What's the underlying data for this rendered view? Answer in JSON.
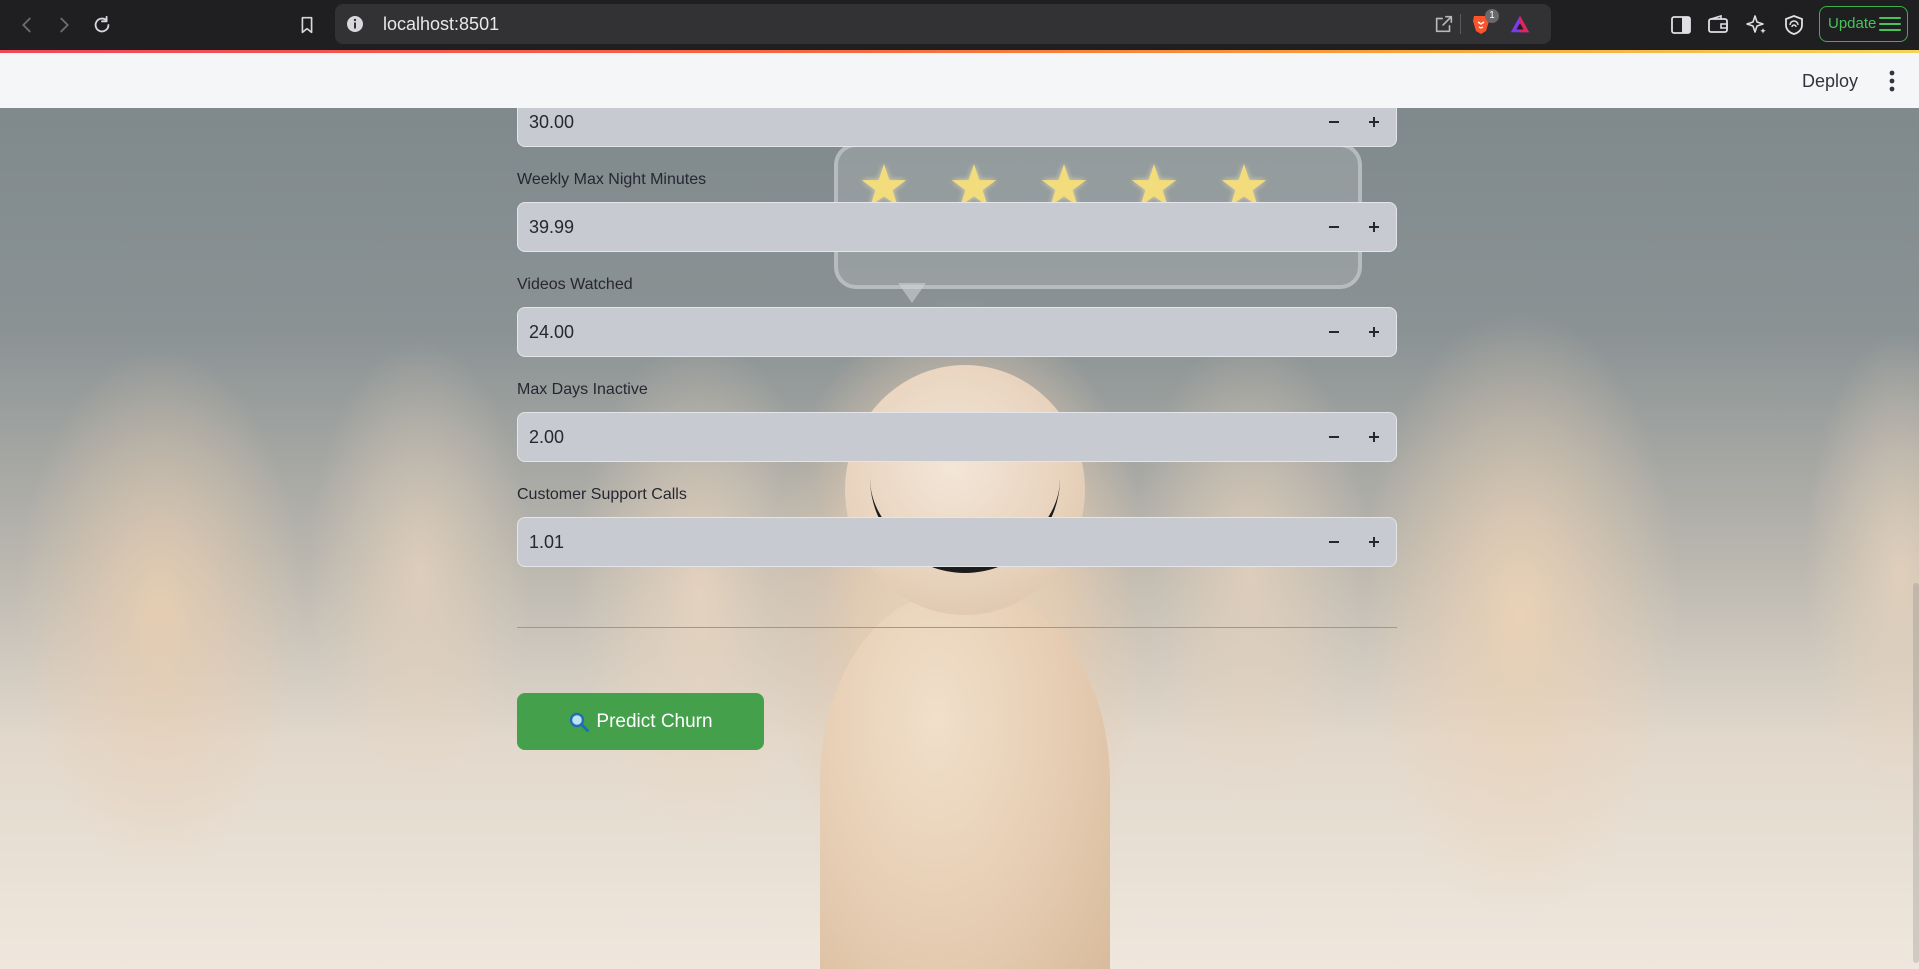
{
  "browser": {
    "url": "localhost:8501",
    "shields_badge": "1",
    "update_label": "Update"
  },
  "app": {
    "header": {
      "deploy_label": "Deploy"
    },
    "fields": [
      {
        "label": "",
        "value": "30.00"
      },
      {
        "label": "Weekly Max Night Minutes",
        "value": "39.99"
      },
      {
        "label": "Videos Watched",
        "value": "24.00"
      },
      {
        "label": "Max Days Inactive",
        "value": "2.00"
      },
      {
        "label": "Customer Support Calls",
        "value": "1.01"
      }
    ],
    "predict_label": "Predict Churn"
  },
  "icons": {
    "back": "chevron-left-icon",
    "forward": "chevron-right-icon",
    "reload": "reload-icon",
    "bookmark": "bookmark-icon",
    "info": "info-icon",
    "share": "share-icon",
    "brave_shields": "brave-lion-icon",
    "rewards": "triangle-rewards-icon",
    "sidebar": "sidebar-icon",
    "wallet": "wallet-icon",
    "leo": "sparkle-icon",
    "vpn": "shield-icon",
    "menu": "hamburger-icon",
    "kebab": "kebab-menu-icon",
    "minus": "minus-icon",
    "plus": "plus-icon",
    "predict": "magnifier-emoji-icon"
  },
  "colors": {
    "accent_green": "#44a04a",
    "update_green": "#46c45a",
    "input_bg": "#c7cbd1"
  }
}
